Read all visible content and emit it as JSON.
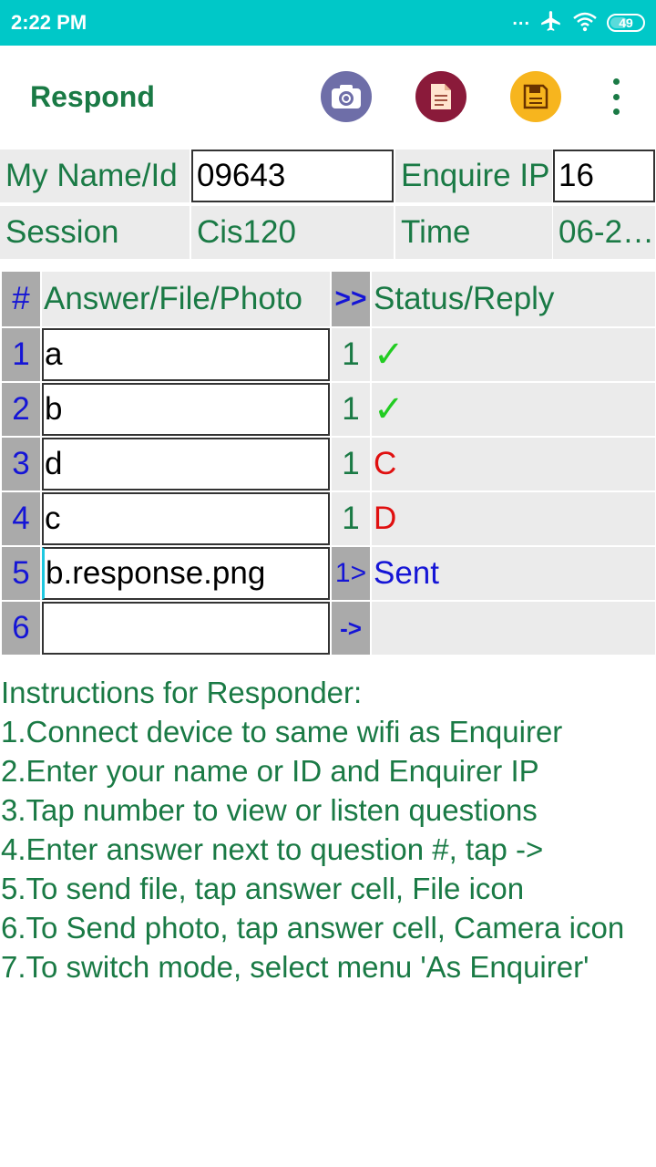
{
  "status_bar": {
    "time": "2:22 PM",
    "dots": "...",
    "battery": "49"
  },
  "app_bar": {
    "title": "Respond",
    "icons": [
      "camera-icon",
      "file-icon",
      "save-icon",
      "more-vert-icon"
    ],
    "colors": {
      "title": "#1a7a45",
      "camera": "#6e6ea8",
      "file": "#8a1a3a",
      "save": "#f7b51e"
    }
  },
  "info": {
    "name_label": "My Name/Id",
    "name_value": "09643",
    "ip_label": "Enquire IP",
    "ip_value": "16",
    "session_label": "Session",
    "session_value": "Cis120",
    "time_label": "Time",
    "time_value": "06-2…"
  },
  "table": {
    "headers": {
      "num": "#",
      "answer": "Answer/File/Photo",
      "go": ">>",
      "status": "Status/Reply"
    },
    "rows": [
      {
        "num": "1",
        "answer": "a",
        "count": "1",
        "status": "✓",
        "status_color": "#22cc22"
      },
      {
        "num": "2",
        "answer": "b",
        "count": "1",
        "status": "✓",
        "status_color": "#22cc22"
      },
      {
        "num": "3",
        "answer": "d",
        "count": "1",
        "status": "C",
        "status_color": "#e01010"
      },
      {
        "num": "4",
        "answer": "c",
        "count": "1",
        "status": "D",
        "status_color": "#e01010"
      },
      {
        "num": "5",
        "answer": "b.response.png",
        "count": "1>",
        "status": "Sent",
        "status_color": "#1515d6"
      },
      {
        "num": "6",
        "answer": "",
        "count": "->",
        "status": "",
        "status_color": "#1515d6"
      }
    ]
  },
  "instructions": {
    "title": "Instructions for Responder:",
    "items": [
      "1.Connect device to same wifi as Enquirer",
      "2.Enter your name or ID and Enquirer IP",
      "3.Tap number to view or listen questions",
      "4.Enter answer next to question #, tap ->",
      "5.To send file, tap answer cell, File icon",
      "6.To Send photo, tap answer cell, Camera icon",
      "7.To switch mode, select menu 'As Enquirer'"
    ]
  }
}
